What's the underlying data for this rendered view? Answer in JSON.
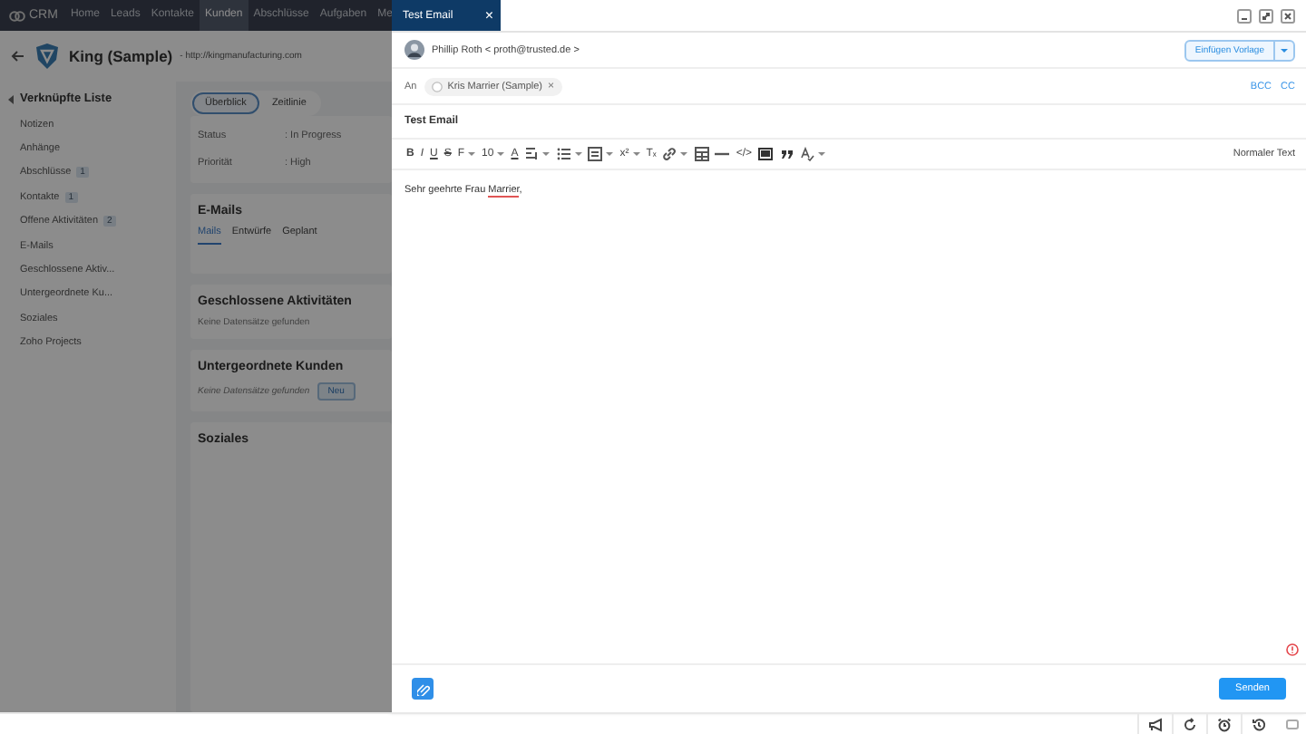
{
  "app": {
    "logo": "CRM",
    "nav": [
      {
        "label": "Home",
        "selected": false
      },
      {
        "label": "Leads",
        "selected": false
      },
      {
        "label": "Kontakte",
        "selected": false
      },
      {
        "label": "Kunden",
        "selected": true
      },
      {
        "label": "Abschlüsse",
        "selected": false
      },
      {
        "label": "Aufgaben",
        "selected": false
      },
      {
        "label": "Me",
        "selected": false
      }
    ],
    "record": {
      "title": "King (Sample)",
      "url": "- http://kingmanufacturing.com"
    },
    "sidebar": {
      "heading": "Verknüpfte Liste",
      "items": [
        {
          "label": "Notizen"
        },
        {
          "label": "Anhänge"
        },
        {
          "label": "Abschlüsse",
          "count": "1"
        },
        {
          "label": "Kontakte",
          "count": "1"
        },
        {
          "label": "Offene Aktivitäten",
          "count": "2"
        },
        {
          "label": "E-Mails"
        },
        {
          "label": "Geschlossene Aktiv..."
        },
        {
          "label": "Untergeordnete Ku..."
        },
        {
          "label": "Soziales"
        },
        {
          "label": "Zoho Projects"
        }
      ]
    },
    "view_tabs": [
      {
        "label": "Überblick",
        "selected": true
      },
      {
        "label": "Zeitlinie",
        "selected": false
      }
    ],
    "fields": [
      {
        "label": "Status",
        "value": ": In Progress"
      },
      {
        "label": "Priorität",
        "value": ": High"
      }
    ],
    "sections": [
      {
        "title": "E-Mails",
        "tabs": [
          {
            "label": "Mails",
            "selected": true
          },
          {
            "label": "Entwürfe",
            "selected": false
          },
          {
            "label": "Geplant",
            "selected": false
          }
        ]
      },
      {
        "title": "Geschlossene Aktivitäten",
        "empty": "Keine Datensätze gefunden"
      },
      {
        "title": "Untergeordnete Kunden",
        "empty": "Keine Datensätze gefunden",
        "button": "Neu"
      },
      {
        "title": "Soziales"
      }
    ]
  },
  "composer": {
    "tab_title": "Test Email",
    "close": "×",
    "from": "Phillip Roth < proth@trusted.de >",
    "template_button": "Einfügen Vorlage",
    "to_label": "An",
    "recipients": [
      {
        "name": "Kris Marrier (Sample)",
        "remove": "×"
      }
    ],
    "bcc": "BCC",
    "cc": "CC",
    "subject": "Test Email",
    "toolbar": [
      {
        "kind": "text",
        "label": "B",
        "caret": false
      },
      {
        "kind": "text",
        "label": "I",
        "caret": false
      },
      {
        "kind": "text",
        "label": "U",
        "caret": false
      },
      {
        "kind": "text",
        "label": "S",
        "caret": false
      },
      {
        "kind": "text",
        "label": "F",
        "caret": true
      },
      {
        "kind": "text",
        "label": "10",
        "caret": true
      },
      {
        "kind": "text",
        "label": "A",
        "caret": false
      },
      {
        "kind": "icon",
        "caret": true
      },
      {
        "kind": "icon",
        "caret": true
      },
      {
        "kind": "icon",
        "caret": true
      },
      {
        "kind": "text",
        "label": "x²",
        "caret": true
      },
      {
        "kind": "text",
        "label": "Tₓ",
        "caret": false
      },
      {
        "kind": "icon",
        "caret": true
      },
      {
        "kind": "icon",
        "caret": false
      },
      {
        "kind": "icon",
        "caret": false
      },
      {
        "kind": "text",
        "label": "</>",
        "caret": false
      },
      {
        "kind": "icon",
        "caret": false
      },
      {
        "kind": "icon",
        "caret": false
      },
      {
        "kind": "icon",
        "caret": true
      }
    ],
    "format": "Normaler Text",
    "body": [
      {
        "text": "Sehr geehrte Frau ",
        "flagged": false
      },
      {
        "text": "Marrier",
        "flagged": true
      },
      {
        "text": ",",
        "flagged": false
      }
    ],
    "send": "Senden"
  }
}
